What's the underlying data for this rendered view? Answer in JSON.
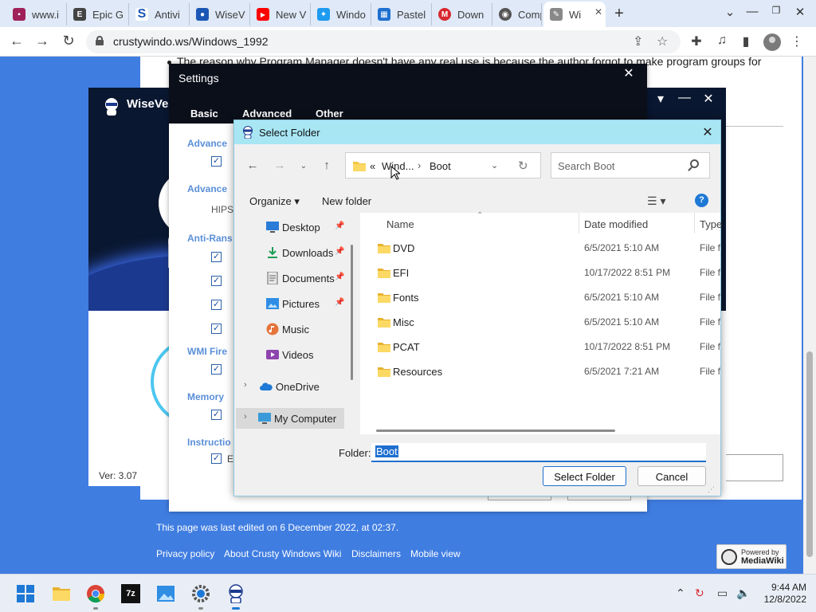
{
  "browser": {
    "tabs": [
      {
        "label": "www.i",
        "icon": "tab-favicon",
        "color": "#a0205a",
        "glyph": "▪"
      },
      {
        "label": "Epic G",
        "icon": "epic-icon",
        "color": "#444444",
        "glyph": "E"
      },
      {
        "label": "Antivi",
        "icon": "antivirus-icon",
        "color": "#1a57b5",
        "glyph": "S"
      },
      {
        "label": "WiseV",
        "icon": "wisevector-icon",
        "color": "#1a57b5",
        "glyph": "●"
      },
      {
        "label": "New V",
        "icon": "youtube-icon",
        "color": "#ff0000",
        "glyph": "▶"
      },
      {
        "label": "Windo",
        "icon": "twitter-icon",
        "color": "#1d9bf0",
        "glyph": "✦"
      },
      {
        "label": "Pastel",
        "icon": "pastel-icon",
        "color": "#1e6fd0",
        "glyph": "▦"
      },
      {
        "label": "Down",
        "icon": "mega-icon",
        "color": "#d9272e",
        "glyph": "M"
      },
      {
        "label": "Comp",
        "icon": "computer-icon",
        "color": "#555555",
        "glyph": "◉"
      },
      {
        "label": "Wi",
        "icon": "wiki-icon",
        "color": "#888888",
        "glyph": "✎",
        "active": true
      }
    ],
    "url": "crustywindo.ws/Windows_1992"
  },
  "webpage": {
    "body_text": "The reason why Program Manager doesn't have any real use is because the author forgot to make program groups for",
    "footer_edited": "This page was last edited on 6 December 2022, at 02:37.",
    "footer_links": [
      "Privacy policy",
      "About Crusty Windows Wiki",
      "Disclaimers",
      "Mobile view"
    ],
    "powered_by_line1": "Powered by",
    "powered_by_line2": "MediaWiki"
  },
  "wisevector": {
    "name": "WiseVec",
    "version": "Ver: 3.07"
  },
  "settings": {
    "title": "Settings",
    "tabs": [
      "Basic",
      "Advanced",
      "Other"
    ],
    "sections": [
      "Advance",
      "Advance",
      "Anti-Rans",
      "WMI Fire",
      "Memory",
      "Instructio"
    ],
    "hips_label": "HIPS",
    "ef_label": "Ef"
  },
  "dialog": {
    "title": "Select Folder",
    "breadcrumb": [
      "«",
      "Wind...",
      "›",
      "Boot"
    ],
    "search_placeholder": "Search Boot",
    "organize_label": "Organize ▾",
    "new_folder_label": "New folder",
    "nav_items": [
      {
        "label": "Desktop",
        "icon": "desktop-icon",
        "pinned": true
      },
      {
        "label": "Downloads",
        "icon": "downloads-icon",
        "pinned": true
      },
      {
        "label": "Documents",
        "icon": "documents-icon",
        "pinned": true
      },
      {
        "label": "Pictures",
        "icon": "pictures-icon",
        "pinned": true
      },
      {
        "label": "Music",
        "icon": "music-icon",
        "pinned": false
      },
      {
        "label": "Videos",
        "icon": "videos-icon",
        "pinned": false
      },
      {
        "label": "OneDrive",
        "icon": "onedrive-icon",
        "pinned": false
      },
      {
        "label": "My Computer",
        "icon": "computer-icon",
        "pinned": false
      }
    ],
    "columns": [
      "Name",
      "Date modified",
      "Type"
    ],
    "files": [
      {
        "name": "DVD",
        "date": "6/5/2021 5:10 AM",
        "type": "File fo"
      },
      {
        "name": "EFI",
        "date": "10/17/2022 8:51 PM",
        "type": "File fo"
      },
      {
        "name": "Fonts",
        "date": "6/5/2021 5:10 AM",
        "type": "File fo"
      },
      {
        "name": "Misc",
        "date": "6/5/2021 5:10 AM",
        "type": "File fo"
      },
      {
        "name": "PCAT",
        "date": "10/17/2022 8:51 PM",
        "type": "File fo"
      },
      {
        "name": "Resources",
        "date": "6/5/2021 7:21 AM",
        "type": "File fo"
      }
    ],
    "folder_label": "Folder:",
    "folder_value": "Boot",
    "select_button": "Select Folder",
    "cancel_button": "Cancel"
  },
  "taskbar": {
    "time": "9:44 AM",
    "date": "12/8/2022"
  },
  "colors": {
    "page_blue": "#3f7de1",
    "dialog_title": "#a8e6f4",
    "accent": "#1e6fd0",
    "folder_yellow": "#f5c542"
  }
}
